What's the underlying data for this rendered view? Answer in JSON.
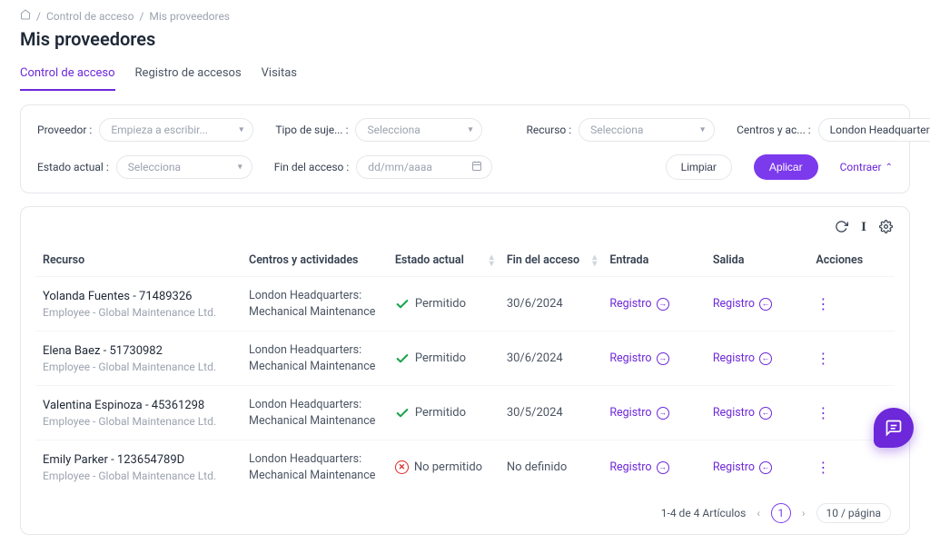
{
  "breadcrumb": {
    "sep": "/",
    "items": [
      "Control de acceso",
      "Mis proveedores"
    ]
  },
  "page_title": "Mis proveedores",
  "tabs": [
    "Control de acceso",
    "Registro de accesos",
    "Visitas"
  ],
  "filters": {
    "proveedor": {
      "label": "Proveedor :",
      "placeholder": "Empieza a escribir..."
    },
    "tipo": {
      "label": "Tipo de suje... :",
      "placeholder": "Selecciona"
    },
    "recurso": {
      "label": "Recurso :",
      "placeholder": "Selecciona"
    },
    "centros": {
      "label": "Centros y ac... :",
      "value": "London Headquarters"
    },
    "estado": {
      "label": "Estado actual :",
      "placeholder": "Selecciona"
    },
    "fin": {
      "label": "Fin del acceso :",
      "placeholder": "dd/mm/aaaa"
    },
    "limpiar": "Limpiar",
    "aplicar": "Aplicar",
    "contraer": "Contraer"
  },
  "columns": [
    "Recurso",
    "Centros y actividades",
    "Estado actual",
    "Fin del acceso",
    "Entrada",
    "Salida",
    "Acciones"
  ],
  "registro_label": "Registro",
  "rows": [
    {
      "name": "Yolanda Fuentes - 71489326",
      "sub": "Employee - Global Maintenance Ltd.",
      "center_line1": "London Headquarters:",
      "center_line2": "Mechanical Maintenance",
      "status": "Permitido",
      "status_ok": true,
      "fin": "30/6/2024"
    },
    {
      "name": "Elena Baez - 51730982",
      "sub": "Employee - Global Maintenance Ltd.",
      "center_line1": "London Headquarters:",
      "center_line2": "Mechanical Maintenance",
      "status": "Permitido",
      "status_ok": true,
      "fin": "30/6/2024"
    },
    {
      "name": "Valentina Espinoza - 45361298",
      "sub": "Employee - Global Maintenance Ltd.",
      "center_line1": "London Headquarters:",
      "center_line2": "Mechanical Maintenance",
      "status": "Permitido",
      "status_ok": true,
      "fin": "30/5/2024"
    },
    {
      "name": "Emily Parker - 123654789D",
      "sub": "Employee - Global Maintenance Ltd.",
      "center_line1": "London Headquarters:",
      "center_line2": "Mechanical Maintenance",
      "status": "No permitido",
      "status_ok": false,
      "fin": "No definido"
    }
  ],
  "pagination": {
    "summary": "1-4 de 4 Artículos",
    "page": "1",
    "size": "10 / página"
  }
}
